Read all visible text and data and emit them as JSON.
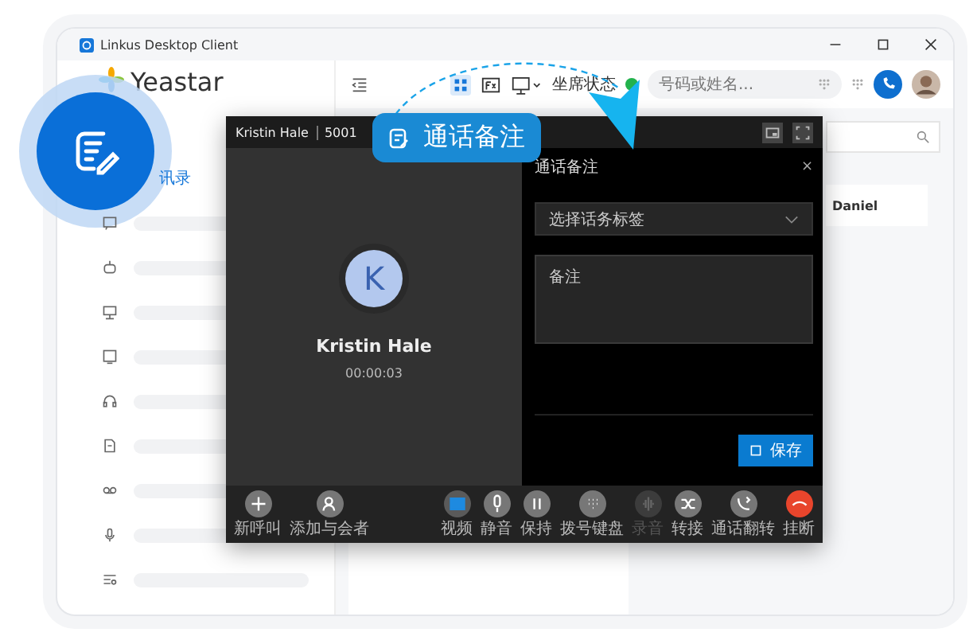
{
  "window": {
    "title": "Linkus Desktop Client"
  },
  "sidebar": {
    "logo": "Yeastar",
    "items": [
      {
        "kind": "contacts",
        "label": "讯录",
        "selected": true
      },
      {
        "kind": "chat",
        "selected": false
      },
      {
        "kind": "robot",
        "selected": false
      },
      {
        "kind": "monitor",
        "selected": false
      },
      {
        "kind": "screen",
        "selected": false
      },
      {
        "kind": "headset",
        "selected": false
      },
      {
        "kind": "doc",
        "selected": false
      },
      {
        "kind": "voicemail",
        "selected": false
      },
      {
        "kind": "mic",
        "selected": false
      },
      {
        "kind": "settings",
        "selected": false
      }
    ]
  },
  "header": {
    "agent_status": "坐席状态",
    "search": {
      "placeholder": "号码或姓名..."
    }
  },
  "content": {
    "contact": "Daniel"
  },
  "call": {
    "name": "Kristin Hale",
    "extension": "5001",
    "initial": "K",
    "caller": "Kristin Hale",
    "duration": "00:00:03",
    "notes": {
      "title": "通话备注",
      "close": "×",
      "tag_select": "选择话务标签",
      "note": {
        "placeholder": "备注"
      },
      "save": "保存"
    },
    "actions_left": [
      {
        "label": "新呼叫",
        "kind": "add",
        "active": false,
        "disabled": false
      },
      {
        "label": "添加与会者",
        "kind": "person",
        "active": false,
        "disabled": false
      }
    ],
    "actions_right": [
      {
        "label": "视频",
        "kind": "video",
        "active": true,
        "disabled": false
      },
      {
        "label": "静音",
        "kind": "mic",
        "active": false,
        "disabled": false
      },
      {
        "label": "保持",
        "kind": "pause",
        "active": false,
        "disabled": false
      },
      {
        "label": "拨号键盘",
        "kind": "dialpad",
        "active": false,
        "disabled": false
      },
      {
        "label": "录音",
        "kind": "record",
        "active": false,
        "disabled": true
      },
      {
        "label": "转接",
        "kind": "transfer",
        "active": false,
        "disabled": false
      },
      {
        "label": "通话翻转",
        "kind": "flip",
        "active": false,
        "disabled": false
      },
      {
        "label": "挂断",
        "kind": "hangup",
        "active": false,
        "disabled": false
      }
    ]
  },
  "callout": {
    "label": "通话备注"
  }
}
